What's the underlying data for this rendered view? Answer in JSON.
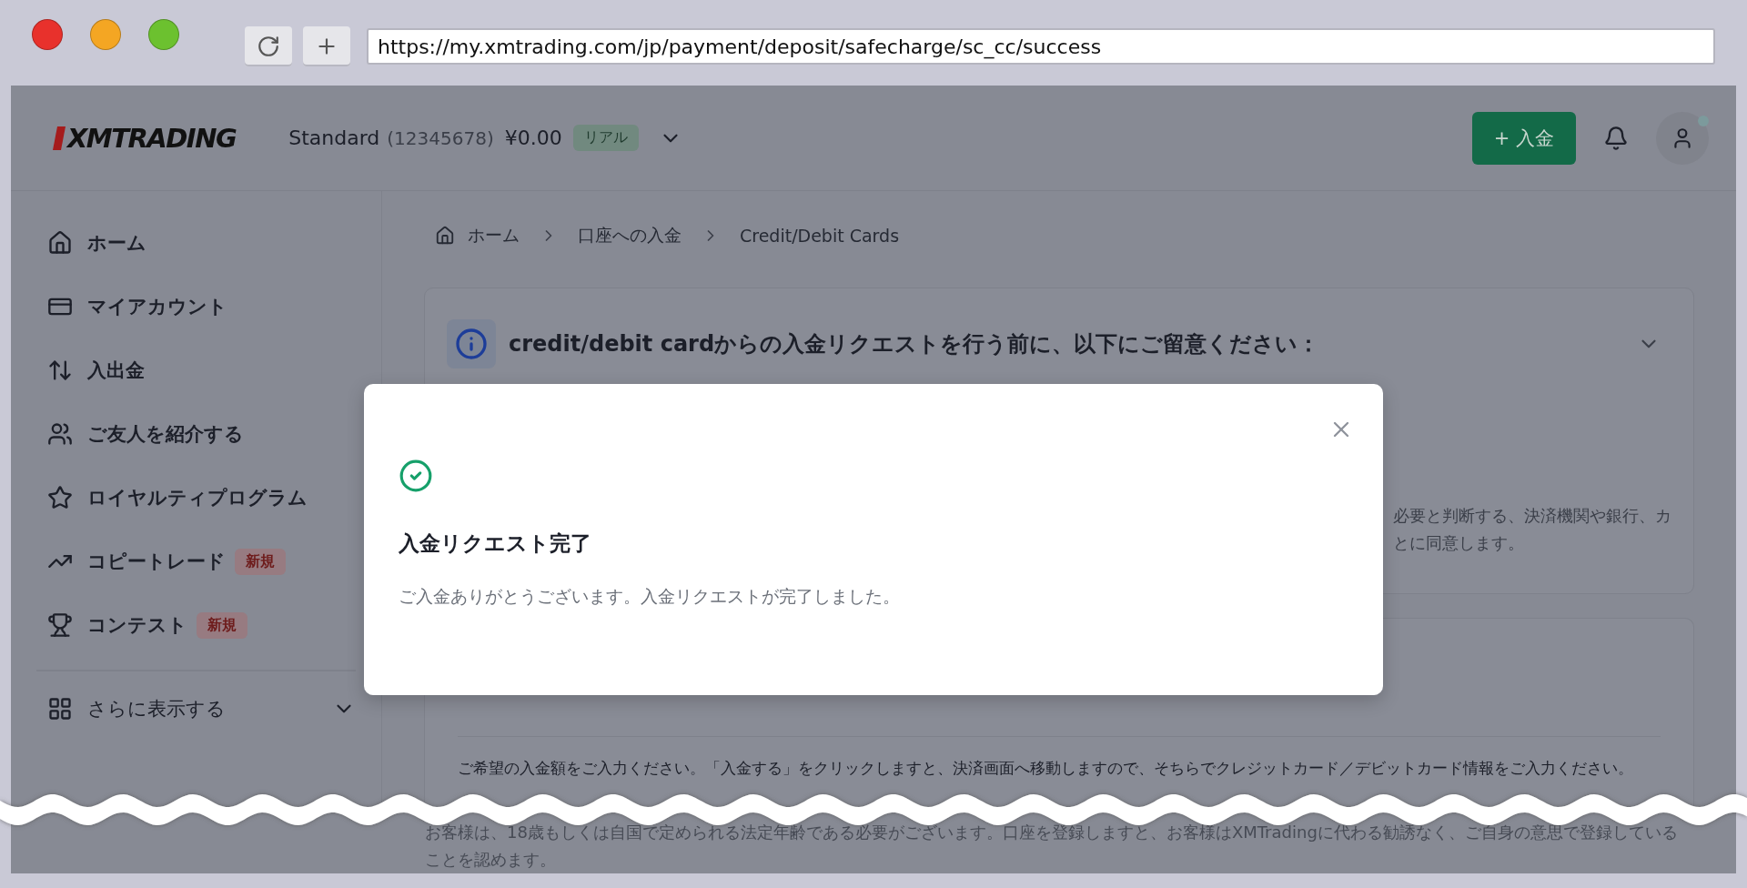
{
  "browser": {
    "url": "https://my.xmtrading.com/jp/payment/deposit/safecharge/sc_cc/success"
  },
  "header": {
    "logo": "XMTRADING",
    "account_type": "Standard",
    "account_number": "(12345678)",
    "balance": "¥0.00",
    "badge": "リアル",
    "deposit_button": "+ 入金"
  },
  "sidebar": {
    "items": [
      {
        "kind": "home",
        "label": "ホーム"
      },
      {
        "kind": "account",
        "label": "マイアカウント"
      },
      {
        "kind": "transfer",
        "label": "入出金"
      },
      {
        "kind": "referral",
        "label": "ご友人を紹介する"
      },
      {
        "kind": "loyalty",
        "label": "ロイヤルティプログラム"
      },
      {
        "kind": "copy",
        "label": "コピートレード",
        "badge": "新規"
      },
      {
        "kind": "contest",
        "label": "コンテスト",
        "badge": "新規"
      }
    ],
    "more": "さらに表示する"
  },
  "breadcrumb": [
    "ホーム",
    "口座への入金",
    "Credit/Debit Cards"
  ],
  "notice": {
    "title": "credit/debit cardからの入金リクエストを行う前に、以下にご留意ください：",
    "visible_lines": [
      "必要と判断する、決済機関や銀行、カ",
      "とに同意します。"
    ]
  },
  "deposit_form": {
    "instructions": "ご希望の入金額をご入力ください。「入金する」をクリックしますと、決済画面へ移動しますので、そちらでクレジットカード／デビットカード情報をご入力ください。",
    "age_notice": "お客様は、18歳もしくは自国で定められる法定年齢である必要がございます。口座を登録しますと、お客様はXMTradingに代わる勧誘なく、ご自身の意思で登録していることを認めます。"
  },
  "modal": {
    "title": "入金リクエスト完了",
    "message": "ご入金ありがとうございます。入金リクエストが完了しました。"
  }
}
